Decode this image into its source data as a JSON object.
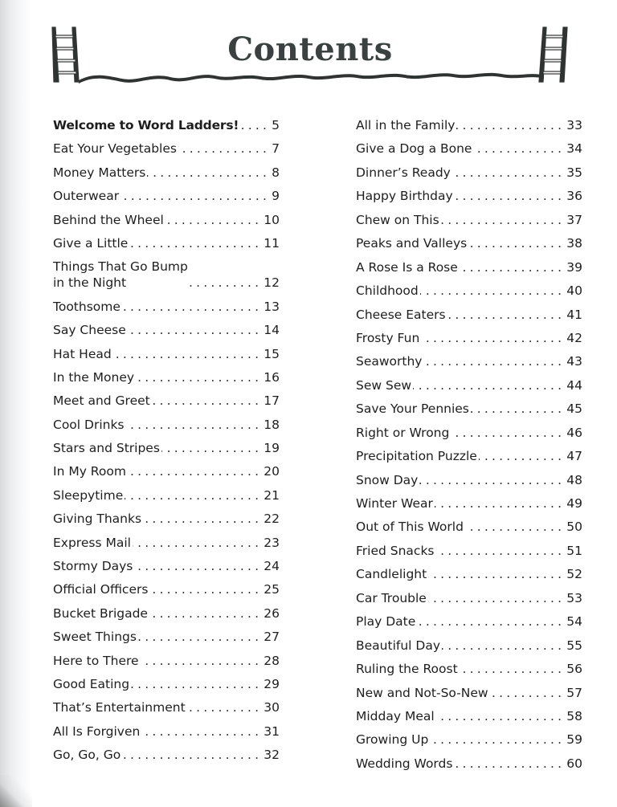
{
  "header": {
    "title": "Contents",
    "left_icon": "ladder-icon",
    "right_icon": "ladder-icon",
    "divider": "wavy-line"
  },
  "colors": {
    "title": "#3b4140",
    "text": "#1e1e1e",
    "ornament": "#2f3433"
  },
  "toc": {
    "left_column": [
      {
        "title": "Welcome to Word Ladders!",
        "page": "5",
        "bold": true
      },
      {
        "title": "Eat Your Vegetables",
        "page": "7"
      },
      {
        "title": "Money Matters",
        "page": "8"
      },
      {
        "title": "Outerwear",
        "page": "9"
      },
      {
        "title": "Behind the Wheel",
        "page": "10"
      },
      {
        "title": "Give a Little",
        "page": "11"
      },
      {
        "title": "Things That Go Bump\nin the Night",
        "page": "12"
      },
      {
        "title": "Toothsome",
        "page": "13"
      },
      {
        "title": "Say Cheese",
        "page": "14"
      },
      {
        "title": "Hat Head",
        "page": "15"
      },
      {
        "title": "In the Money",
        "page": "16"
      },
      {
        "title": "Meet and Greet",
        "page": "17"
      },
      {
        "title": "Cool Drinks",
        "page": "18"
      },
      {
        "title": "Stars and Stripes",
        "page": "19"
      },
      {
        "title": "In My Room",
        "page": "20"
      },
      {
        "title": "Sleepytime",
        "page": "21"
      },
      {
        "title": "Giving Thanks",
        "page": "22"
      },
      {
        "title": "Express Mail",
        "page": "23"
      },
      {
        "title": "Stormy Days",
        "page": "24"
      },
      {
        "title": "Official Officers",
        "page": "25"
      },
      {
        "title": "Bucket Brigade",
        "page": "26"
      },
      {
        "title": "Sweet Things",
        "page": "27"
      },
      {
        "title": "Here to There",
        "page": "28"
      },
      {
        "title": "Good Eating",
        "page": "29"
      },
      {
        "title": "That’s Entertainment",
        "page": "30"
      },
      {
        "title": "All Is Forgiven",
        "page": "31"
      },
      {
        "title": "Go, Go, Go",
        "page": "32"
      }
    ],
    "right_column": [
      {
        "title": "All in the Family",
        "page": "33"
      },
      {
        "title": "Give a Dog a Bone",
        "page": "34"
      },
      {
        "title": "Dinner’s Ready",
        "page": "35"
      },
      {
        "title": "Happy Birthday",
        "page": "36"
      },
      {
        "title": "Chew on This",
        "page": "37"
      },
      {
        "title": "Peaks and Valleys",
        "page": "38"
      },
      {
        "title": "A Rose Is a Rose",
        "page": "39"
      },
      {
        "title": "Childhood",
        "page": "40"
      },
      {
        "title": "Cheese Eaters",
        "page": "41"
      },
      {
        "title": "Frosty Fun",
        "page": "42"
      },
      {
        "title": "Seaworthy",
        "page": "43"
      },
      {
        "title": "Sew Sew",
        "page": "44"
      },
      {
        "title": "Save Your Pennies",
        "page": "45"
      },
      {
        "title": "Right or Wrong",
        "page": "46"
      },
      {
        "title": "Precipitation Puzzle",
        "page": "47"
      },
      {
        "title": "Snow Day",
        "page": "48"
      },
      {
        "title": "Winter Wear",
        "page": "49"
      },
      {
        "title": "Out of This World",
        "page": "50"
      },
      {
        "title": "Fried Snacks",
        "page": "51"
      },
      {
        "title": "Candlelight",
        "page": "52"
      },
      {
        "title": "Car Trouble",
        "page": "53"
      },
      {
        "title": "Play Date",
        "page": "54"
      },
      {
        "title": "Beautiful Day",
        "page": "55"
      },
      {
        "title": "Ruling the Roost",
        "page": "56"
      },
      {
        "title": "New and Not-So-New",
        "page": "57"
      },
      {
        "title": "Midday Meal",
        "page": "58"
      },
      {
        "title": "Growing Up",
        "page": "59"
      },
      {
        "title": "Wedding Words",
        "page": "60"
      }
    ],
    "leader_char": ". "
  }
}
